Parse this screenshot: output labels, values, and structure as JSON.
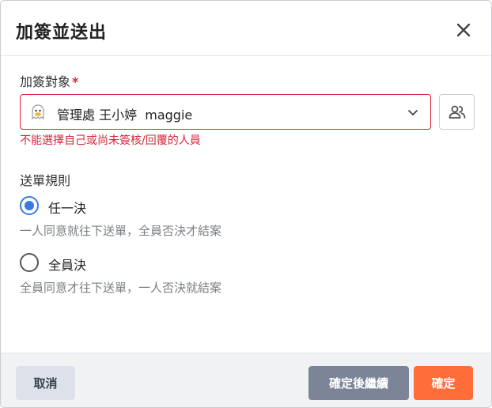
{
  "dialog": {
    "title": "加簽並送出",
    "close_icon": "close-icon"
  },
  "cosign": {
    "label": "加簽對象",
    "required_mark": "*",
    "selected_value": "管理處 王小婷  maggie",
    "avatar_icon": "avatar-ghost-icon",
    "dropdown_icon": "chevron-down-icon",
    "picker_icon": "people-icon",
    "error": "不能選擇自己或尚未簽核/回覆的人員",
    "error_color": "#d9263a"
  },
  "rule": {
    "label": "送單規則",
    "options": [
      {
        "label": "任一決",
        "description": "一人同意就往下送單，全員否決才結案",
        "checked": true
      },
      {
        "label": "全員決",
        "description": "全員同意才往下送單，一人否決就結案",
        "checked": false
      }
    ],
    "accent_color": "#3b7be0"
  },
  "footer": {
    "cancel_label": "取消",
    "continue_label": "確定後繼續",
    "confirm_label": "確定",
    "confirm_color": "#ff6d3a"
  }
}
